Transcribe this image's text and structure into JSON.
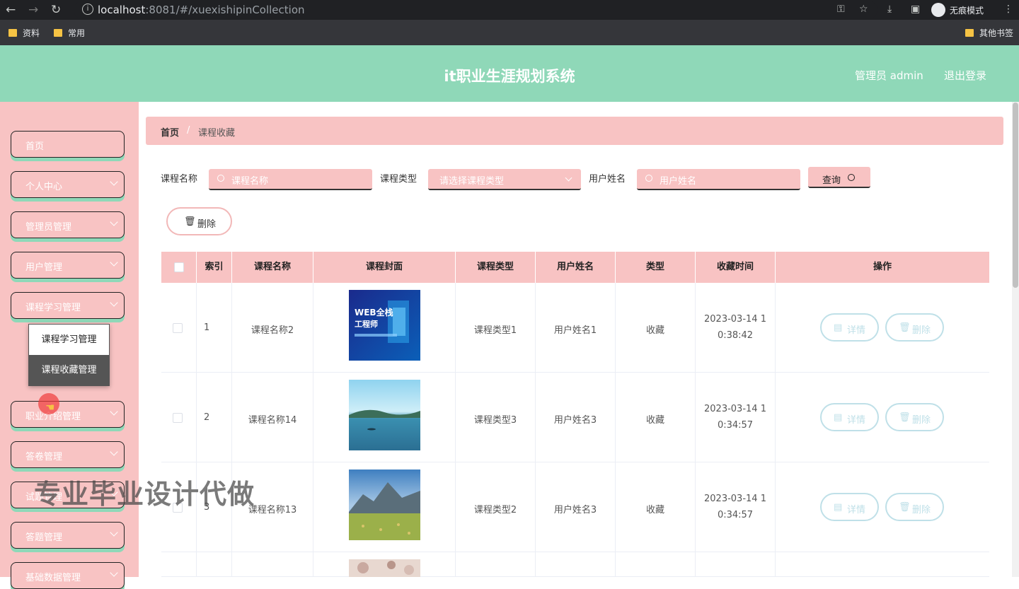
{
  "browser": {
    "url_host": "localhost",
    "url_rest": ":8081/#/xuexishipinCollection",
    "incognito_label": "无痕模式",
    "bookmarks": [
      "资料",
      "常用"
    ],
    "other_bookmarks": "其他书签"
  },
  "header": {
    "title": "it职业生涯规划系统",
    "user": "管理员 admin",
    "logout": "退出登录"
  },
  "sidebar": {
    "items": [
      {
        "label": "首页"
      },
      {
        "label": "个人中心"
      },
      {
        "label": "管理员管理"
      },
      {
        "label": "用户管理"
      },
      {
        "label": "课程学习管理"
      },
      {
        "label": "职业介绍管理"
      },
      {
        "label": "答卷管理"
      },
      {
        "label": "试题管理"
      },
      {
        "label": "答题管理"
      },
      {
        "label": "基础数据管理"
      }
    ],
    "submenu": [
      "课程学习管理",
      "课程收藏管理"
    ]
  },
  "watermark": "专业毕业设计代做",
  "breadcrumb": {
    "home": "首页",
    "separator": "/",
    "current": "课程收藏"
  },
  "search": {
    "course_name_label": "课程名称",
    "course_name_placeholder": "课程名称",
    "course_type_label": "课程类型",
    "course_type_placeholder": "请选择课程类型",
    "user_name_label": "用户姓名",
    "user_name_placeholder": "用户姓名",
    "query_button": "查询"
  },
  "toolbar": {
    "delete_button": "删除"
  },
  "table": {
    "headers": [
      "索引",
      "课程名称",
      "课程封面",
      "课程类型",
      "用户姓名",
      "类型",
      "收藏时间",
      "操作"
    ],
    "rows": [
      {
        "index": "1",
        "name": "课程名称2",
        "type": "课程类型1",
        "user": "用户姓名1",
        "kind": "收藏",
        "time1": "2023-03-14 1",
        "time2": "0:38:42",
        "cover": "web-course-cover"
      },
      {
        "index": "2",
        "name": "课程名称14",
        "type": "课程类型3",
        "user": "用户姓名3",
        "kind": "收藏",
        "time1": "2023-03-14 1",
        "time2": "0:34:57",
        "cover": "lake-cover"
      },
      {
        "index": "3",
        "name": "课程名称13",
        "type": "课程类型2",
        "user": "用户姓名3",
        "kind": "收藏",
        "time1": "2023-03-14 1",
        "time2": "0:34:57",
        "cover": "mountain-cover"
      }
    ],
    "detail_button": "详情",
    "delete_button": "删除"
  },
  "colors": {
    "header": "#8fd8b8",
    "sidebar": "#f8c3c3",
    "accent": "#bfe0e8"
  }
}
